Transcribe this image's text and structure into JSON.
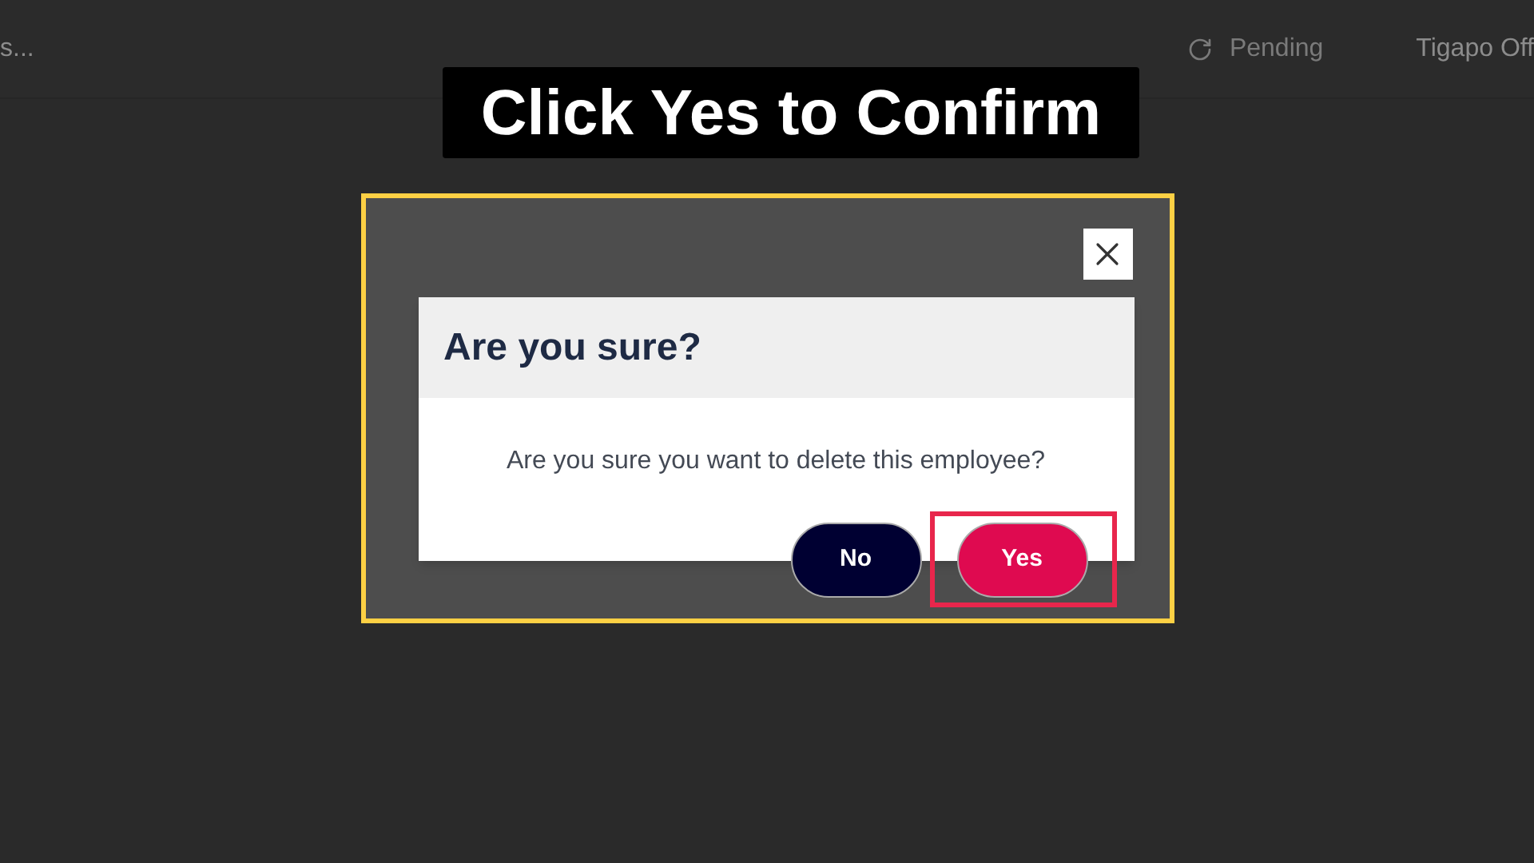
{
  "top_bar": {
    "left_text": "s...",
    "status": {
      "label": "Pending"
    },
    "account": "Tigapo Off"
  },
  "caption": "Click Yes to Confirm",
  "dialog": {
    "title": "Are you sure?",
    "message": "Are you sure you want to delete this employee?",
    "buttons": [
      {
        "label": "No",
        "kind": "secondary",
        "highlighted": false
      },
      {
        "label": "Yes",
        "kind": "primary",
        "highlighted": true
      }
    ]
  }
}
